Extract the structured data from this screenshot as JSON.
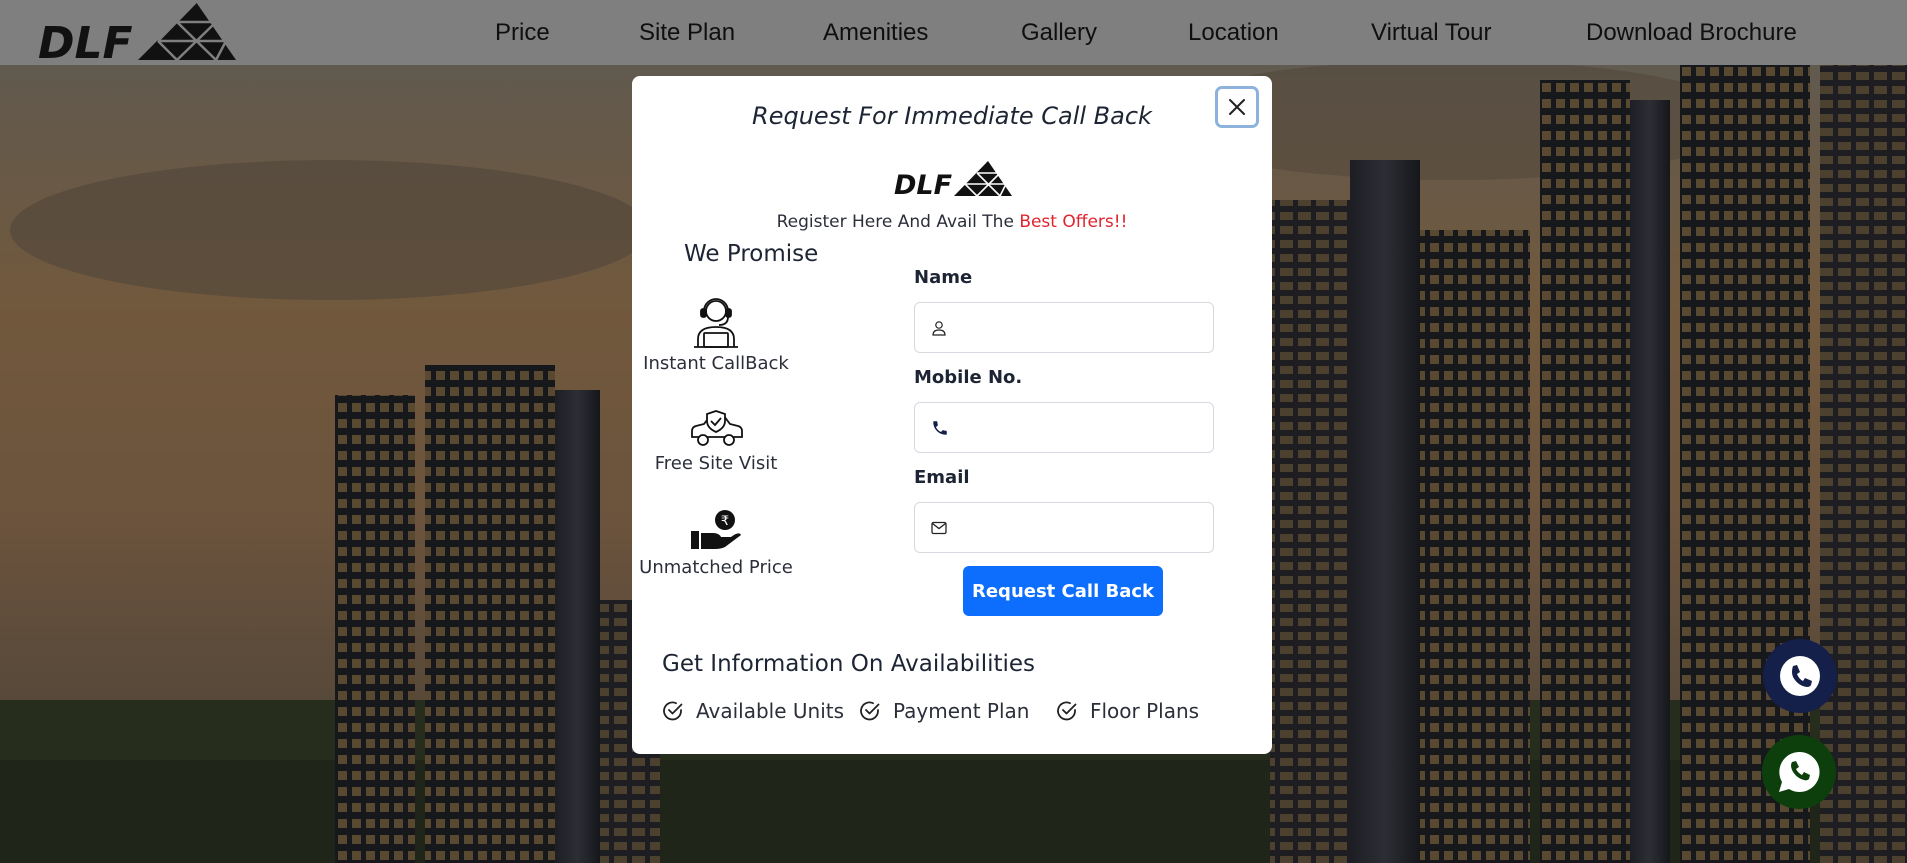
{
  "header": {
    "logo_text": "DLF",
    "nav": [
      "Price",
      "Site Plan",
      "Amenities",
      "Gallery",
      "Location",
      "Virtual Tour",
      "Download Brochure"
    ]
  },
  "modal": {
    "title": "Request For Immediate Call Back",
    "logo_text": "DLF",
    "tagline_prefix": "Register Here And Avail The",
    "tagline_highlight": "Best Offers!!",
    "promise_title": "We Promise",
    "promises": [
      {
        "label": "Instant CallBack",
        "icon": "support-agent-icon"
      },
      {
        "label": "Free Site Visit",
        "icon": "car-shield-icon"
      },
      {
        "label": "Unmatched Price",
        "icon": "rupee-hand-icon"
      }
    ],
    "form": {
      "name_label": "Name",
      "name_value": "",
      "mobile_label": "Mobile No.",
      "mobile_value": "",
      "email_label": "Email",
      "email_value": "",
      "submit_label": "Request Call Back"
    },
    "info_title": "Get Information On Availabilities",
    "info_items": [
      "Available Units",
      "Payment Plan",
      "Floor Plans"
    ]
  },
  "colors": {
    "primary_button": "#0d6efd",
    "highlight": "#e0242f",
    "call_fab": "#141f4a",
    "whatsapp_fab": "#0d3f0d"
  },
  "fabs": {
    "call_icon": "phone-icon",
    "whatsapp_icon": "whatsapp-icon"
  }
}
